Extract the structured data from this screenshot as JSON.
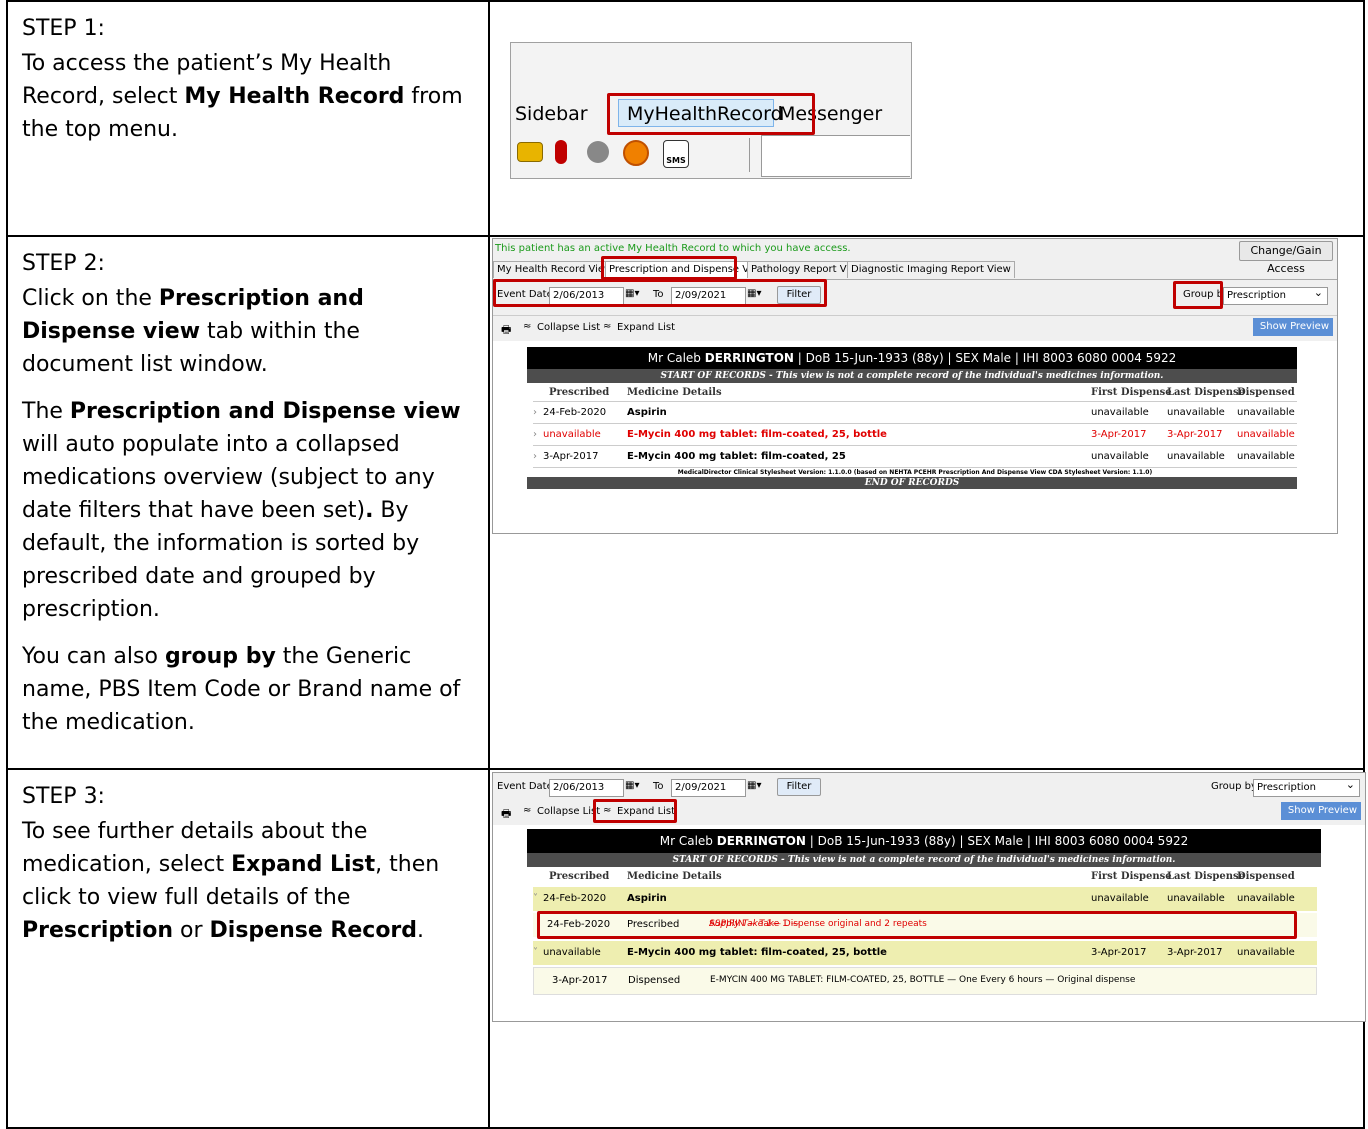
{
  "step1": {
    "heading": "STEP 1:",
    "text_before": "To access the patient’s My Health Record, select ",
    "text_bold": "My Health Record",
    "text_after": " from the top menu.",
    "menu": [
      "Sidebar",
      "MyHealthRecord",
      "Messenger"
    ],
    "sms_label": "SMS"
  },
  "step2": {
    "heading": "STEP 2:",
    "p1_a": "Click on the ",
    "p1_b": "Prescription and Dispense view",
    "p1_c": " tab within the document list window.",
    "p2_a": "The ",
    "p2_b": "Prescription and Dispense view",
    "p2_c": " will auto populate into a collapsed medications overview (subject to any date filters that have been set)",
    "p2_d": ".",
    "p2_e": " By default, the information is sorted by prescribed date and grouped by prescription.",
    "p3_a": "You can also ",
    "p3_b": "group by",
    "p3_c": " the Generic name, PBS Item Code or Brand name of the medication."
  },
  "step3": {
    "heading": "STEP 3:",
    "p_a": "To see further details about the medication, select ",
    "p_b": "Expand List",
    "p_c": ", then click to view full details of the ",
    "p_d": "Prescription",
    "p_e": " or ",
    "p_f": "Dispense Record",
    "p_g": "."
  },
  "app": {
    "access_msg": "This patient has an active My Health Record to which you have access.",
    "change_access": "Change/Gain Access",
    "tabs": [
      "My Health Record View",
      "Prescription and Dispense View",
      "Pathology Report View",
      "Diagnostic Imaging Report View"
    ],
    "event_date_label": "Event Date",
    "from_date": "2/06/2013",
    "to_label": "To",
    "to_date": "2/09/2021",
    "filter": "Filter",
    "group_by_label": "Group by",
    "group_by_value": "Prescription",
    "collapse": "Collapse List",
    "expand": "Expand List",
    "show_preview": "Show Preview",
    "patient_prefix": "Mr Caleb ",
    "patient_surname": "DERRINGTON",
    "patient_rest": "|    DoB 15-Jun-1933 (88y)    |  SEX Male  |  IHI 8003 6080 0004 5922",
    "start_records_a": "START OF RECORDS",
    "start_records_b": " - This view is not a complete record of the individual's medicines information.",
    "cols": [
      "Prescribed",
      "Medicine Details",
      "First Dispense",
      "Last Dispense",
      "Dispensed"
    ],
    "rows": [
      {
        "date": "24-Feb-2020",
        "med": "Aspirin",
        "first": "unavailable",
        "last": "unavailable",
        "disp": "unavailable"
      },
      {
        "date": "unavailable",
        "med": "E-Mycin 400 mg tablet: film-coated, 25, bottle",
        "first": "3-Apr-2017",
        "last": "3-Apr-2017",
        "disp": "unavailable"
      },
      {
        "date": "3-Apr-2017",
        "med": "E-Mycin 400 mg tablet: film-coated, 25",
        "first": "unavailable",
        "last": "unavailable",
        "disp": "unavailable"
      }
    ],
    "stylesheet_note": "MedicalDirector Clinical Stylesheet Version: 1.1.0.0 (based on NEHTA PCEHR Prescription And Dispense View CDA Stylesheet Version: 1.1.0)",
    "end_records": "END OF RECORDS",
    "expanded": {
      "row1": {
        "date": "24-Feb-2020",
        "med": "Aspirin",
        "first": "unavailable",
        "last": "unavailable",
        "disp": "unavailable"
      },
      "sub1": {
        "date": "24-Feb-2020",
        "type": "Prescribed",
        "text_a": "ASPIRIN — Take 1 — ",
        "text_b": "Supply Take 1",
        "text_c": " — Dispense original and 2 repeats"
      },
      "row2": {
        "date": "unavailable",
        "med": "E-Mycin 400 mg tablet: film-coated, 25, bottle",
        "first": "3-Apr-2017",
        "last": "3-Apr-2017",
        "disp": "unavailable"
      },
      "sub2": {
        "date": "3-Apr-2017",
        "type": "Dispensed",
        "text": "E-MYCIN 400 MG TABLET: FILM-COATED, 25, BOTTLE — One Every 6 hours — Original dispense"
      }
    }
  }
}
